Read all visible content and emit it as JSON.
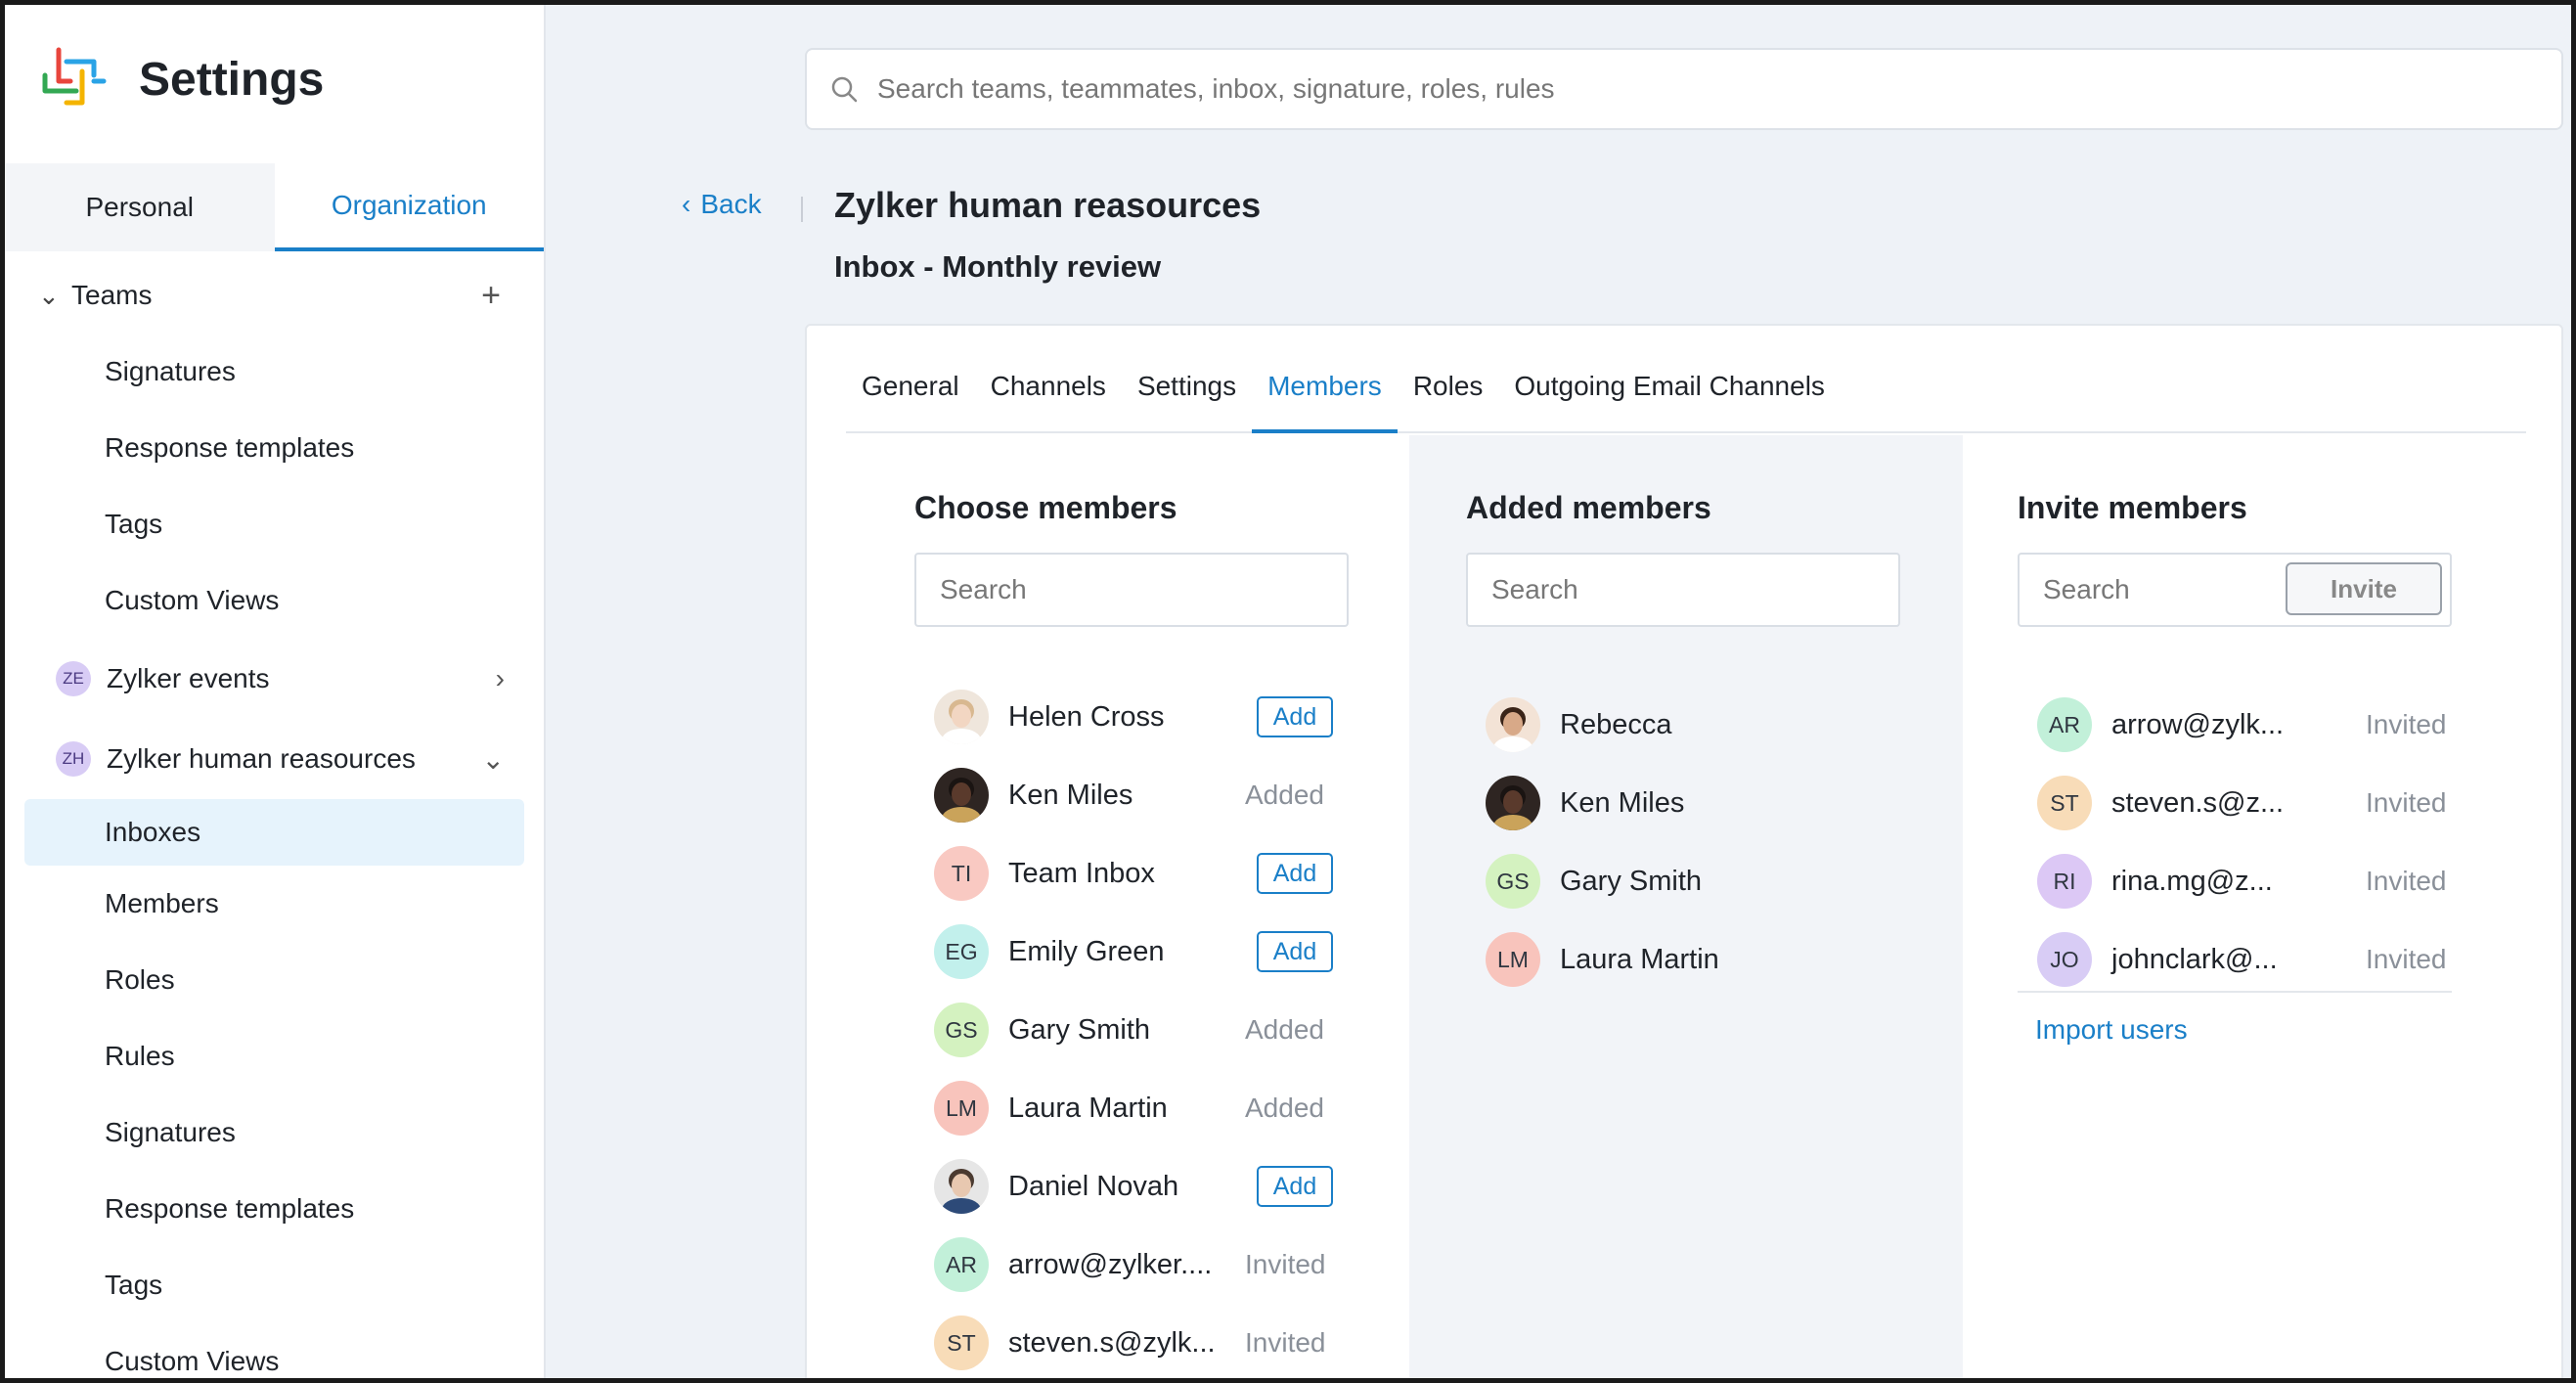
{
  "app": {
    "title": "Settings",
    "brand_colors": [
      "#e8453c",
      "#f4b400",
      "#2aa3e6",
      "#33a853"
    ]
  },
  "mode_tabs": [
    "Personal",
    "Organization"
  ],
  "sidebar": {
    "teams_label": "Teams",
    "teams_items": [
      "Signatures",
      "Response templates",
      "Tags",
      "Custom Views"
    ],
    "teams_list": [
      {
        "initials": "ZE",
        "name": "Zylker events"
      },
      {
        "initials": "ZH",
        "name": "Zylker human reasources"
      }
    ],
    "sub_items": [
      "Inboxes",
      "Members",
      "Roles",
      "Rules",
      "Signatures",
      "Response templates",
      "Tags",
      "Custom Views"
    ]
  },
  "search": {
    "placeholder": "Search teams, teammates, inbox, signature, roles, rules"
  },
  "header": {
    "back_label": "Back",
    "title": "Zylker human reasources",
    "subtitle": "Inbox - Monthly review"
  },
  "tabs": [
    "General",
    "Channels",
    "Settings",
    "Members",
    "Roles",
    "Outgoing Email Channels"
  ],
  "choose": {
    "title": "Choose members",
    "search_placeholder": "Search",
    "add_label": "Add",
    "rows": [
      {
        "initials": "",
        "name": "Helen Cross",
        "status": "Add",
        "color": "#f3e5d8",
        "photo": "helen"
      },
      {
        "initials": "",
        "name": "Ken Miles",
        "status": "Added",
        "color": "#3b2d27",
        "photo": "ken"
      },
      {
        "initials": "TI",
        "name": "Team Inbox",
        "status": "Add",
        "color": "#f9c9c2"
      },
      {
        "initials": "EG",
        "name": "Emily Green",
        "status": "Add",
        "color": "#c2f0ec"
      },
      {
        "initials": "GS",
        "name": "Gary Smith",
        "status": "Added",
        "color": "#d4f2c0"
      },
      {
        "initials": "LM",
        "name": "Laura Martin",
        "status": "Added",
        "color": "#f8c4bc"
      },
      {
        "initials": "",
        "name": "Daniel Novah",
        "status": "Add",
        "color": "#e3e3e3",
        "photo": "daniel"
      },
      {
        "initials": "AR",
        "name": "arrow@zylker....",
        "status": "Invited",
        "color": "#c2f0d9"
      },
      {
        "initials": "ST",
        "name": "steven.s@zylk...",
        "status": "Invited",
        "color": "#f8dcb8"
      }
    ]
  },
  "added": {
    "title": "Added members",
    "search_placeholder": "Search",
    "rows": [
      {
        "initials": "",
        "name": "Rebecca",
        "color": "#e8c4a8",
        "photo": "rebecca"
      },
      {
        "initials": "",
        "name": "Ken Miles",
        "color": "#3b2d27",
        "photo": "ken"
      },
      {
        "initials": "GS",
        "name": "Gary Smith",
        "color": "#d4f2c0"
      },
      {
        "initials": "LM",
        "name": "Laura Martin",
        "color": "#f8c4bc"
      }
    ]
  },
  "invite": {
    "title": "Invite members",
    "search_placeholder": "Search",
    "button_label": "Invite",
    "rows": [
      {
        "initials": "AR",
        "name": "arrow@zylk...",
        "status": "Invited",
        "color": "#c2f0d9"
      },
      {
        "initials": "ST",
        "name": "steven.s@z...",
        "status": "Invited",
        "color": "#f8dcb8"
      },
      {
        "initials": "RI",
        "name": "rina.mg@z...",
        "status": "Invited",
        "color": "#dcc8f5"
      },
      {
        "initials": "JO",
        "name": "johnclark@...",
        "status": "Invited",
        "color": "#d8ccf5"
      }
    ],
    "import_label": "Import users"
  }
}
